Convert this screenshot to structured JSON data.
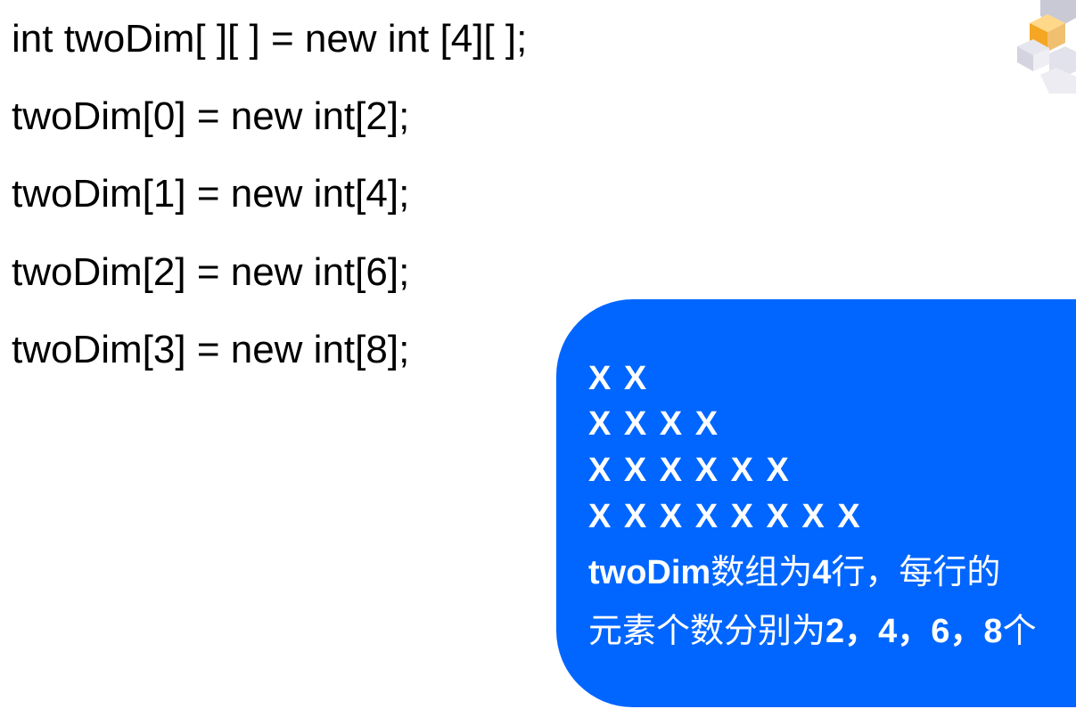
{
  "code": {
    "lines": [
      "int twoDim[ ][ ] = new int [4][ ];",
      "twoDim[0] = new int[2];",
      "twoDim[1] = new int[4];",
      "twoDim[2] = new int[6];",
      "twoDim[3] = new int[8];"
    ]
  },
  "callout": {
    "rows": [
      "X X",
      "X X X X",
      "X X X X X X",
      "X X X X X X X X"
    ],
    "note_line1": {
      "p1": "twoDim",
      "p2": "数组为",
      "p3": "4",
      "p4": "行，每行的"
    },
    "note_line2": {
      "p1": "元素个数分别为",
      "p2": "2，4，6，8",
      "p3": "个"
    }
  }
}
